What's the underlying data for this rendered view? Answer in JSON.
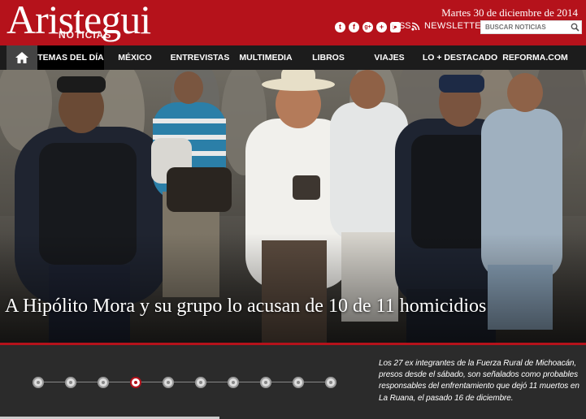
{
  "header": {
    "logo": "Aristegui",
    "logo_sub": "NOTICIAS",
    "date": "Martes 30 de diciembre de 2014",
    "social_icons": [
      "twitter-icon",
      "facebook-icon",
      "google-plus-icon",
      "youtube-icon"
    ],
    "rss_label": "RSS",
    "newsletter_label": "NEWSLETTER",
    "search_placeholder": "BUSCAR NOTICIAS"
  },
  "nav": {
    "items": [
      "TEMAS DEL DÍA",
      "MÉXICO",
      "ENTREVISTAS",
      "MULTIMEDIA",
      "LIBROS",
      "VIAJES",
      "LO + DESTACADO",
      "REFORMA.COM"
    ]
  },
  "hero": {
    "headline": "A Hipólito Mora y su grupo lo acusan de 10 de 11 homicidios"
  },
  "slider": {
    "count": 10,
    "active_index": 3
  },
  "summary": "Los 27 ex integrantes de la Fuerza Rural de Michoacán, presos desde el sábado, son señalados como probables responsables del enfrentamiento que dejó 11 muertos en La Ruana, el pasado 16 de diciembre.",
  "colors": {
    "brand_red": "#b5121b",
    "nav_bg": "#1c1c1c",
    "page_bg": "#2b2b2b"
  }
}
